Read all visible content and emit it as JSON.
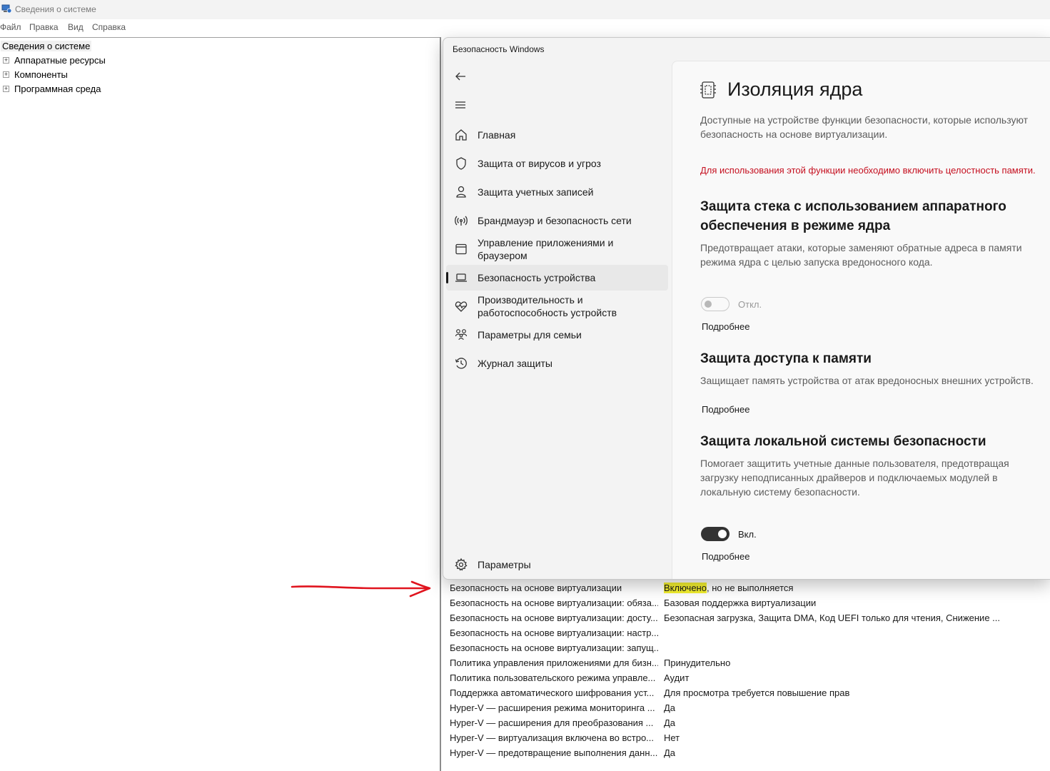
{
  "msinfo": {
    "title": "Сведения о системе",
    "menu": [
      "Файл",
      "Правка",
      "Вид",
      "Справка"
    ],
    "tree": {
      "root": "Сведения о системе",
      "items": [
        {
          "label": "Аппаратные ресурсы",
          "expander": "+"
        },
        {
          "label": "Компоненты",
          "expander": "+"
        },
        {
          "label": "Программная среда",
          "expander": "+"
        }
      ]
    },
    "rows": [
      {
        "item": "Безопасность на основе виртуализации",
        "value_highlight": "Включено",
        "value_rest": ", но не выполняется"
      },
      {
        "item": "Безопасность на основе виртуализации: обяза...",
        "value": "Базовая поддержка виртуализации"
      },
      {
        "item": "Безопасность на основе виртуализации: досту...",
        "value": "Безопасная загрузка, Защита DMA, Код UEFI только для чтения, Снижение ..."
      },
      {
        "item": "Безопасность на основе виртуализации: настр...",
        "value": ""
      },
      {
        "item": "Безопасность на основе виртуализации: запущ...",
        "value": ""
      },
      {
        "item": "Политика управления приложениями для бизн...",
        "value": "Принудительно"
      },
      {
        "item": "Политика пользовательского режима управле...",
        "value": "Аудит"
      },
      {
        "item": "Поддержка автоматического шифрования уст...",
        "value": "Для просмотра требуется повышение прав"
      },
      {
        "item": "Hyper-V — расширения режима мониторинга ...",
        "value": "Да"
      },
      {
        "item": "Hyper-V — расширения для преобразования ...",
        "value": "Да"
      },
      {
        "item": "Hyper-V — виртуализация включена во встро...",
        "value": "Нет"
      },
      {
        "item": "Hyper-V — предотвращение выполнения данн...",
        "value": "Да"
      }
    ]
  },
  "security": {
    "title": "Безопасность Windows",
    "back_icon": "back-arrow-icon",
    "menu_icon": "hamburger-icon",
    "nav": [
      {
        "label": "Главная",
        "icon": "home-icon"
      },
      {
        "label": "Защита от вирусов и угроз",
        "icon": "shield-icon"
      },
      {
        "label": "Защита учетных записей",
        "icon": "person-icon"
      },
      {
        "label": "Брандмауэр и безопасность сети",
        "icon": "wifi-signal-icon"
      },
      {
        "label": "Управление приложениями и браузером",
        "icon": "app-window-icon"
      },
      {
        "label": "Безопасность устройства",
        "icon": "laptop-icon",
        "active": true
      },
      {
        "label": "Производительность и работоспособность устройств",
        "icon": "heart-pulse-icon"
      },
      {
        "label": "Параметры для семьи",
        "icon": "family-icon"
      },
      {
        "label": "Журнал защиты",
        "icon": "history-icon"
      }
    ],
    "settings_label": "Параметры",
    "page": {
      "title": "Изоляция ядра",
      "description": "Доступные на устройстве функции безопасности, которые используют безопасность на основе виртуализации.",
      "warning": "Для использования этой функции необходимо включить целостность памяти.",
      "sections": [
        {
          "heading": "Защита стека с использованием аппаратного обеспечения в режиме ядра",
          "description": "Предотвращает атаки, которые заменяют обратные адреса в памяти режима ядра с целью запуска вредоносного кода.",
          "toggle_state": "off",
          "toggle_label": "Откл.",
          "link": "Подробнее"
        },
        {
          "heading": "Защита доступа к памяти",
          "description": "Защищает память устройства от атак вредоносных внешних устройств.",
          "link": "Подробнее"
        },
        {
          "heading": "Защита локальной системы безопасности",
          "description": "Помогает защитить учетные данные пользователя, предотвращая загрузку неподписанных драйверов и подключаемых модулей в локальную систему безопасности.",
          "toggle_state": "on",
          "toggle_label": "Вкл.",
          "link": "Подробнее"
        }
      ]
    }
  },
  "colors": {
    "warning": "#c50f1f",
    "highlight": "#f4f030",
    "annotation_arrow": "#e0141e",
    "toggle_on": "#333333"
  }
}
